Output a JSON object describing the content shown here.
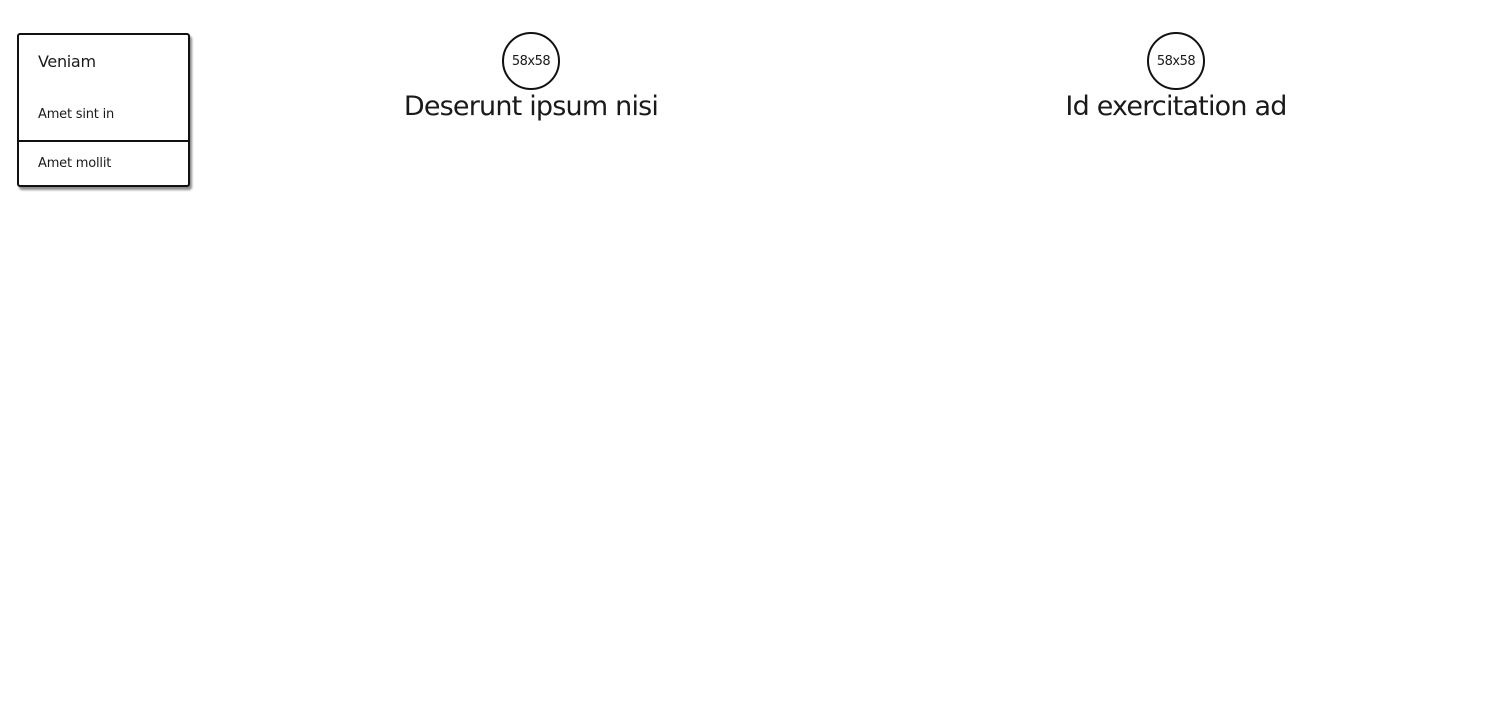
{
  "menu": {
    "title": "Veniam",
    "items": [
      {
        "label": "Amet sint in"
      },
      {
        "label": "Amet mollit"
      }
    ]
  },
  "profiles": [
    {
      "avatar_label": "58x58",
      "name": "Deserunt ipsum nisi"
    },
    {
      "avatar_label": "58x58",
      "name": "Id exercitation ad"
    }
  ]
}
